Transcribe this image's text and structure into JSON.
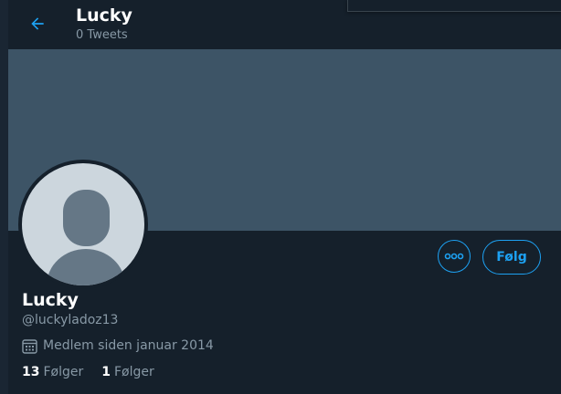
{
  "header": {
    "back_icon": "arrow-left-icon",
    "name": "Lucky",
    "tweets": "0 Tweets"
  },
  "colors": {
    "accent": "#1da1f2",
    "background": "#15202b",
    "banner": "#3d5466",
    "secondary_text": "#8899a6"
  },
  "actions": {
    "more_icon": "more-options-icon",
    "follow_label": "Følg"
  },
  "profile": {
    "name": "Lucky",
    "handle": "@luckyladoz13",
    "joined_icon": "calendar-icon",
    "joined": "Medlem siden januar 2014",
    "following_count": "13",
    "following_label": "Følger",
    "followers_count": "1",
    "followers_label": "Følger"
  }
}
